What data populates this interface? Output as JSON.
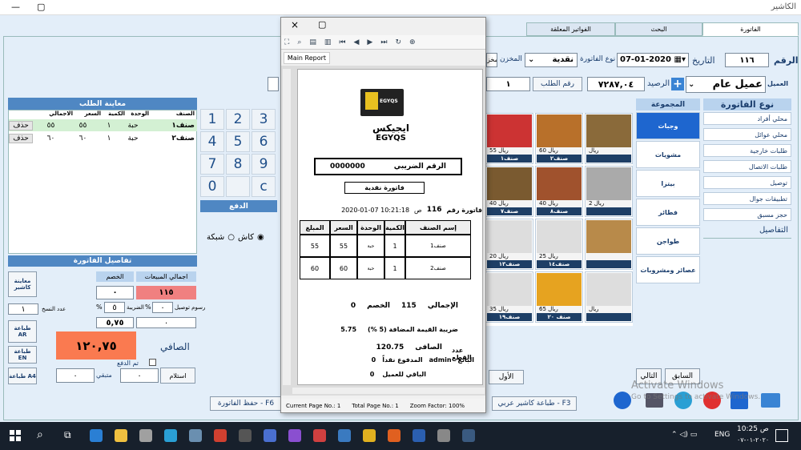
{
  "window": {
    "title": "الكاشير",
    "min": "—",
    "max": "▢"
  },
  "tabs": [
    {
      "label": "الفاتورة"
    },
    {
      "label": "البحث"
    },
    {
      "label": "الفواتير المعلقة"
    }
  ],
  "invoice": {
    "number_label": "الرقم",
    "number": "١١٦",
    "date_label": "التاريخ",
    "date": "07-01-2020",
    "type_label": "نوع الفاتورة",
    "type": "نقدية",
    "store_label": "المخزن",
    "store": "المخز",
    "customer_label": "العميل",
    "customer": "عميل عام",
    "balance_label": "الرصيد",
    "balance": "٧٢٨٧,٠٤",
    "order_no_label": "رقم الطلب",
    "order_no": "١"
  },
  "order_preview": {
    "title": "معاينة الطلب",
    "headers": [
      "الصنف",
      "الوحدة",
      "الكمية",
      "السعر",
      "الاجمالي"
    ],
    "rows": [
      {
        "item": "صنف١",
        "unit": "حبة",
        "qty": "١",
        "price": "٥٥",
        "total": "٥٥",
        "del": "حذف"
      },
      {
        "item": "صنف٢",
        "unit": "حبة",
        "qty": "١",
        "price": "٦٠",
        "total": "٦٠",
        "del": "حذف"
      }
    ]
  },
  "numpad": {
    "keys": [
      "1",
      "2",
      "3",
      "4",
      "5",
      "6",
      "7",
      "8",
      "9",
      "0",
      "",
      "c"
    ],
    "pay_label": "الدفع",
    "cash": "كاش",
    "network": "شبكة"
  },
  "details": {
    "title": "تفاصيل الفاتورة",
    "total_sales_label": "اجمالي المبيعات",
    "total_sales": "١١٥",
    "discount_label": "الخصم",
    "discount": "٠",
    "percent": "%",
    "tax_label": "الضريبة",
    "tax_pct": "٥",
    "tax_value": "٥,٧٥",
    "delivery_label": "رسوم توصيل",
    "delivery": "٠",
    "nett_label": "الصافي",
    "nett": "١٢٠,٧٥",
    "paid_label": "تم الدفع",
    "received_label": "استلام",
    "received": "٠",
    "remaining_label": "متبقي",
    "remaining": "٠",
    "copies_label": "عدد النسخ",
    "copies": "١",
    "preview_cashier": "معاينة كاشير",
    "print_ar": "طباعة AR",
    "print_en": "طباعة EN",
    "print_a4": "طباعة A4"
  },
  "groups": {
    "title": "المجموعة",
    "items": [
      "وجبات",
      "مشويات",
      "بيتزا",
      "فطائر",
      "طواجن",
      "عصائر ومشروبات"
    ]
  },
  "invoice_types": {
    "title": "نوع الفاتورة",
    "items": [
      "محلي أفراد",
      "محلي عوائل",
      "طلبات خارجية",
      "طلبات الاتصال",
      "توصيل",
      "تطبيقات جوال",
      "حجز مسبق"
    ],
    "details": "التفاصيل"
  },
  "products": [
    {
      "name": "صنف١",
      "price": "ريال 55",
      "color": "#c33"
    },
    {
      "name": "صنف٢",
      "price": "ريال 60",
      "color": "#b8702a"
    },
    {
      "name": "",
      "price": "ريال",
      "color": "#8a6a3a"
    },
    {
      "name": "صنف٧",
      "price": "ريال 40",
      "color": "#7a5a30"
    },
    {
      "name": "صنف٨",
      "price": "ريال 40",
      "color": "#a0522d"
    },
    {
      "name": "",
      "price": "ريال 2",
      "color": "#aaa"
    },
    {
      "name": "صنف١٣",
      "price": "ريال 20",
      "color": "#ddd"
    },
    {
      "name": "صنف١٤",
      "price": "ريال 25",
      "color": "#ddd"
    },
    {
      "name": "",
      "price": "",
      "color": "#b88a4a"
    },
    {
      "name": "صنف١٩",
      "price": "ريال 35",
      "color": "#ddd"
    },
    {
      "name": "صنف ٢٠",
      "price": "ريال 65",
      "color": "#e6a320"
    },
    {
      "name": "",
      "price": "ريال",
      "color": "#ddd"
    }
  ],
  "nav": {
    "first": "الأول",
    "prev": "السابق",
    "next": "التالي"
  },
  "bottom": {
    "f3": "طباعة كاشير عربي - F3",
    "f6": "حفظ الفاتورة - F6"
  },
  "watermark": {
    "line1": "Activate Windows",
    "line2": "Go to Settings to activate Windows."
  },
  "report": {
    "close": "×",
    "max": "▢",
    "tab": "Main Report",
    "logo_text": "EGYQS",
    "company_ar": "ايجيكس",
    "company_en": "EGYQS",
    "tax_no_label": "الرقم الضريبي",
    "tax_no": "0000000",
    "invoice_type": "فاتورة نقدية",
    "invoice_no_label": "فاتورة رقم",
    "invoice_no": "116",
    "time_label": "ص",
    "datetime": "2020-01-07 10:21:18",
    "headers": [
      "إسم الصنف",
      "الكمية",
      "الوحدة",
      "السعر",
      "المبلغ"
    ],
    "rows": [
      {
        "item": "صنف1",
        "qty": "1",
        "unit": "حبة",
        "price": "55",
        "amount": "55"
      },
      {
        "item": "صنف2",
        "qty": "1",
        "unit": "حبة",
        "price": "60",
        "amount": "60"
      }
    ],
    "total_label": "الإجمالي",
    "total": "115",
    "discount_label": "الخصم",
    "discount": "0",
    "tax_label": "ضريبة القيمة المضافة (5 %)",
    "tax": "5.75",
    "pieces_label": "عدد القطع",
    "nett_label": "الصافى",
    "nett": "120.75",
    "seller_label": "البائع",
    "seller": "admin",
    "paid_label": "المدفوع نقداً",
    "paid": "0",
    "remaining_label": "الباقي للعميل",
    "remaining": "0",
    "status_page": "Current Page No.: 1",
    "status_total": "Total Page No.: 1",
    "status_zoom": "Zoom Factor: 100%"
  },
  "taskbar": {
    "lang": "ENG",
    "time": "10:25 ص",
    "date": "٢٠٢٠-٠١-٠٧",
    "icons": [
      {
        "name": "edge",
        "color": "#2a7fd4"
      },
      {
        "name": "file-explorer",
        "color": "#f0c040"
      },
      {
        "name": "app-1",
        "color": "#a0a0a0"
      },
      {
        "name": "app-2",
        "color": "#2a9fd4"
      },
      {
        "name": "app-3",
        "color": "#6a8fb0"
      },
      {
        "name": "app-4",
        "color": "#d04030"
      },
      {
        "name": "calculator",
        "color": "#555"
      },
      {
        "name": "app-5",
        "color": "#4a6fd0"
      },
      {
        "name": "visual-studio",
        "color": "#8a4fd0"
      },
      {
        "name": "app-6",
        "color": "#d04040"
      },
      {
        "name": "app-7",
        "color": "#3a7ac0"
      },
      {
        "name": "chrome",
        "color": "#e0b020"
      },
      {
        "name": "firefox",
        "color": "#e06020"
      },
      {
        "name": "word",
        "color": "#2b5fb0"
      },
      {
        "name": "app-8",
        "color": "#888"
      },
      {
        "name": "app-active",
        "color": "#3a5a80"
      }
    ]
  }
}
